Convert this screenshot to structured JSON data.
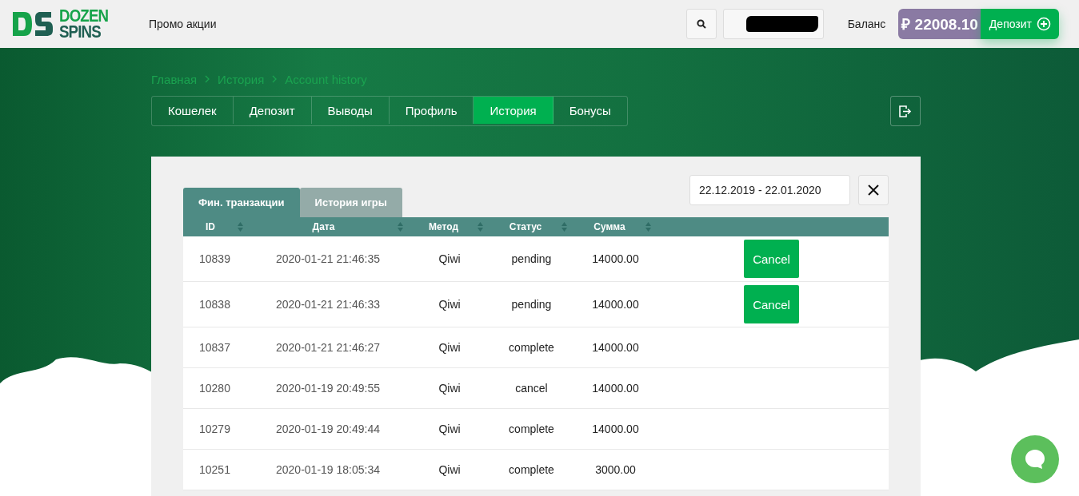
{
  "header": {
    "logo": {
      "line_1": "DOZEN",
      "line_2": "SPINS"
    },
    "nav_link": "Промо акции",
    "balance_label": "Баланс",
    "balance_amount": "₽ 22008.10",
    "deposit_button": "Депозит"
  },
  "breadcrumbs": [
    "Главная",
    "История",
    "Account history"
  ],
  "account_tabs": [
    {
      "label": "Кошелек",
      "selected": false
    },
    {
      "label": "Депозит",
      "selected": false
    },
    {
      "label": "Выводы",
      "selected": false
    },
    {
      "label": "Профиль",
      "selected": false
    },
    {
      "label": "История",
      "selected": true
    },
    {
      "label": "Бонусы",
      "selected": false
    }
  ],
  "history_tabs": [
    {
      "label": "Фин. транзакции",
      "selected": true
    },
    {
      "label": "История игры",
      "selected": false
    }
  ],
  "date_range": {
    "value": "22.12.2019 - 22.01.2020"
  },
  "table": {
    "columns": [
      "ID",
      "Дата",
      "Метод",
      "Статус",
      "Сумма"
    ],
    "rows": [
      {
        "id": "10839",
        "date": "2020-01-21 21:46:35",
        "method": "Qiwi",
        "status": "pending",
        "amount": "14000.00",
        "action": "Cancel"
      },
      {
        "id": "10838",
        "date": "2020-01-21 21:46:33",
        "method": "Qiwi",
        "status": "pending",
        "amount": "14000.00",
        "action": "Cancel"
      },
      {
        "id": "10837",
        "date": "2020-01-21 21:46:27",
        "method": "Qiwi",
        "status": "complete",
        "amount": "14000.00"
      },
      {
        "id": "10280",
        "date": "2020-01-19 20:49:55",
        "method": "Qiwi",
        "status": "cancel",
        "amount": "14000.00"
      },
      {
        "id": "10279",
        "date": "2020-01-19 20:49:44",
        "method": "Qiwi",
        "status": "complete",
        "amount": "14000.00"
      },
      {
        "id": "10251",
        "date": "2020-01-19 18:05:34",
        "method": "Qiwi",
        "status": "complete",
        "amount": "3000.00"
      }
    ]
  }
}
